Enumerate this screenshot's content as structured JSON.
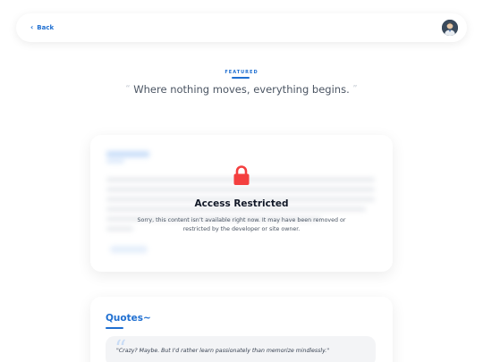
{
  "topbar": {
    "back_label": "Back",
    "back_icon": "chevron-left-icon",
    "avatar_icon": "user-avatar"
  },
  "featured": {
    "label": "FEATURED",
    "quote": "Where nothing moves, everything begins.",
    "open_mark": "“",
    "close_mark": "”"
  },
  "restricted": {
    "lock_icon": "lock-icon",
    "title": "Access Restricted",
    "message": "Sorry, this content isn’t available right now. It may have been removed or restricted by the developer or site owner."
  },
  "quotes": {
    "title": "Quotes~",
    "mark": "“",
    "items": [
      {
        "text": "\"Crazy? Maybe. But I'd rather learn passionately than memorize mindlessly.\""
      }
    ]
  },
  "colors": {
    "accent": "#1f6fd1",
    "lock": "#f43f3f",
    "card_bg": "#ffffff",
    "quote_bg": "#f3f4f6"
  }
}
